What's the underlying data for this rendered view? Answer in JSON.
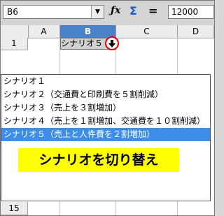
{
  "formula_bar": {
    "name_box_value": "B6",
    "input_value": "12000",
    "function_wizard_icon": "fx-icon",
    "sum_icon": "sum-icon",
    "equals_icon": "equals-icon"
  },
  "grid": {
    "columns": [
      "A",
      "B",
      "C",
      "D"
    ],
    "rows": [
      "1",
      "15"
    ],
    "cell_b1_value": "シナリオ５"
  },
  "scenario_list": {
    "items": [
      "シナリオ１",
      "シナリオ２（交通費と印刷費を５割削減）",
      "シナリオ３（売上を３割増加）",
      "シナリオ４（売上を１割増加、交通費を１０割削減）",
      "シナリオ５（売上と人件費を２割増加）"
    ],
    "selected_index": 4
  },
  "annotation": {
    "text": "シナリオを切り替え",
    "highlight_color": "#ffff00",
    "marker_color": "#e00000"
  },
  "colors": {
    "selection": "#3d8ee8",
    "column_highlight": "#4a82c9"
  }
}
